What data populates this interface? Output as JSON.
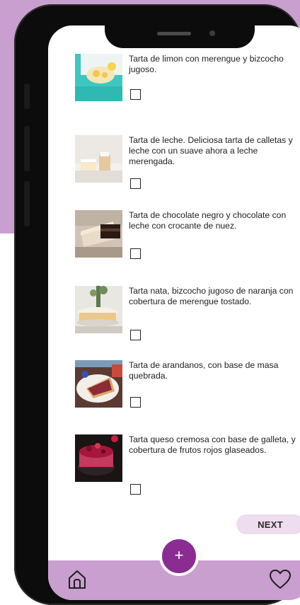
{
  "colors": {
    "background_accent": "#c99fcf",
    "fab": "#8b2c93",
    "next_button_bg": "#eedcef",
    "bottom_bar": "#c99fcf"
  },
  "items": [
    {
      "description": "Tarta de limon con merengue y bizcocho jugoso.",
      "checked": false,
      "image": "lemon-meringue-cake-image"
    },
    {
      "description": "Tarta de leche. Deliciosa tarta de calletas y leche con un suave ahora a leche merengada.",
      "checked": false,
      "image": "milk-cake-image"
    },
    {
      "description": "Tarta de chocolate negro y chocolate con leche con crocante de nuez.",
      "checked": false,
      "image": "chocolate-cake-image"
    },
    {
      "description": "Tarta nata, bizcocho jugoso de naranja con cobertura de merengue tostado.",
      "checked": false,
      "image": "cream-orange-cake-image"
    },
    {
      "description": "Tarta de arandanos, con base de masa quebrada.",
      "checked": false,
      "image": "blueberry-tart-image"
    },
    {
      "description": "Tarta queso cremosa con base de galleta, y cobertura de frutos rojos glaseados.",
      "checked": false,
      "image": "cheesecake-red-berries-image"
    }
  ],
  "next_button": {
    "label": "NEXT"
  },
  "fab": {
    "label": "+"
  },
  "bottom_nav": {
    "home_icon": "home-icon",
    "favorites_icon": "heart-icon"
  }
}
